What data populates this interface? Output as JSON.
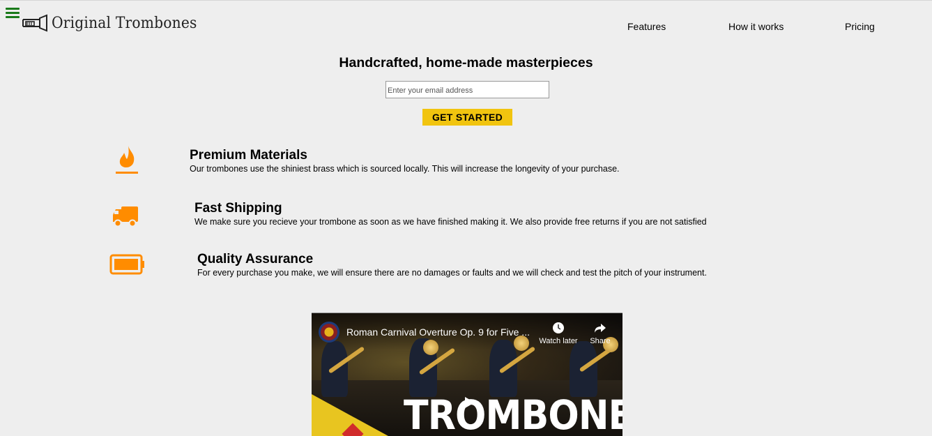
{
  "header": {
    "logo_text": "Original Trombones",
    "nav": [
      {
        "label": "Features"
      },
      {
        "label": "How it works"
      },
      {
        "label": "Pricing"
      }
    ]
  },
  "hero": {
    "title": "Handcrafted, home-made masterpieces",
    "email_placeholder": "Enter your email address",
    "cta_label": "GET STARTED"
  },
  "features": [
    {
      "icon": "flame-icon",
      "title": "Premium Materials",
      "description": "Our trombones use the shiniest brass which is sourced locally. This will increase the longevity of your purchase."
    },
    {
      "icon": "truck-icon",
      "title": "Fast Shipping",
      "description": "We make sure you recieve your trombone as soon as we have finished making it. We also provide free returns if you are not satisfied"
    },
    {
      "icon": "battery-icon",
      "title": "Quality Assurance",
      "description": "For every purchase you make, we will ensure there are no damages or faults and we will check and test the pitch of your instrument."
    }
  ],
  "video": {
    "title": "Roman Carnival Overture Op. 9 for Five ...",
    "watch_later": "Watch later",
    "share": "Share",
    "overlay_text": "TROMBONE"
  },
  "colors": {
    "accent": "#f1c40f",
    "icon_orange": "#ff8c00",
    "hamburger": "#1a7a1a",
    "background": "#eeeeee"
  }
}
